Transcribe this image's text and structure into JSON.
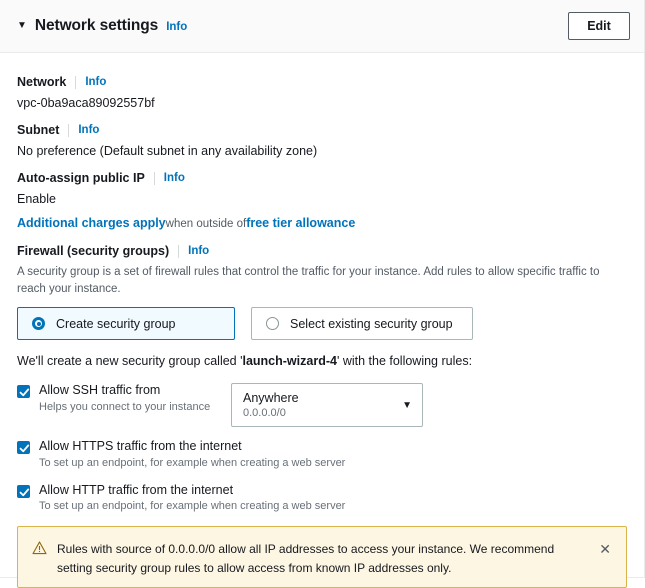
{
  "header": {
    "caret_glyph": "▼",
    "title": "Network settings",
    "info_label": "Info",
    "edit_label": "Edit"
  },
  "network": {
    "label": "Network",
    "info_label": "Info",
    "value": "vpc-0ba9aca89092557bf"
  },
  "subnet": {
    "label": "Subnet",
    "info_label": "Info",
    "value": "No preference (Default subnet in any availability zone)"
  },
  "auto_assign_ip": {
    "label": "Auto-assign public IP",
    "info_label": "Info",
    "value": "Enable",
    "charges_link": "Additional charges apply",
    "charges_mid": "when outside of",
    "charges_link2": "free tier allowance"
  },
  "firewall": {
    "label": "Firewall (security groups)",
    "info_label": "Info",
    "description": "A security group is a set of firewall rules that control the traffic for your instance. Add rules to allow specific traffic to reach your instance.",
    "options": [
      {
        "label": "Create security group",
        "selected": true
      },
      {
        "label": "Select existing security group",
        "selected": false
      }
    ],
    "create_note_prefix": "We'll create a new security group called '",
    "create_note_name": "launch-wizard-4",
    "create_note_suffix": "' with the following rules:"
  },
  "rules": [
    {
      "title": "Allow SSH traffic from",
      "subtitle": "Helps you connect to your instance",
      "checked": true,
      "has_select": true,
      "select_main": "Anywhere",
      "select_sub": "0.0.0.0/0",
      "select_caret": "▼"
    },
    {
      "title": "Allow HTTPS traffic from the internet",
      "subtitle": "To set up an endpoint, for example when creating a web server",
      "checked": true,
      "has_select": false
    },
    {
      "title": "Allow HTTP traffic from the internet",
      "subtitle": "To set up an endpoint, for example when creating a web server",
      "checked": true,
      "has_select": false
    }
  ],
  "alert": {
    "icon": "warning-triangle-icon",
    "text": "Rules with source of 0.0.0.0/0 allow all IP addresses to access your instance. We recommend setting security group rules to allow access from known IP addresses only.",
    "close_glyph": "✕"
  },
  "colors": {
    "accent": "#0073bb",
    "link": "#0073bb",
    "warning_bg": "#fdf6e3",
    "warning_border": "#d9b44a",
    "warning_icon": "#906806",
    "header_bg": "#fafafa",
    "selected_tile_bg": "#f1faff",
    "text": "#16191f",
    "muted_text": "#687078"
  }
}
